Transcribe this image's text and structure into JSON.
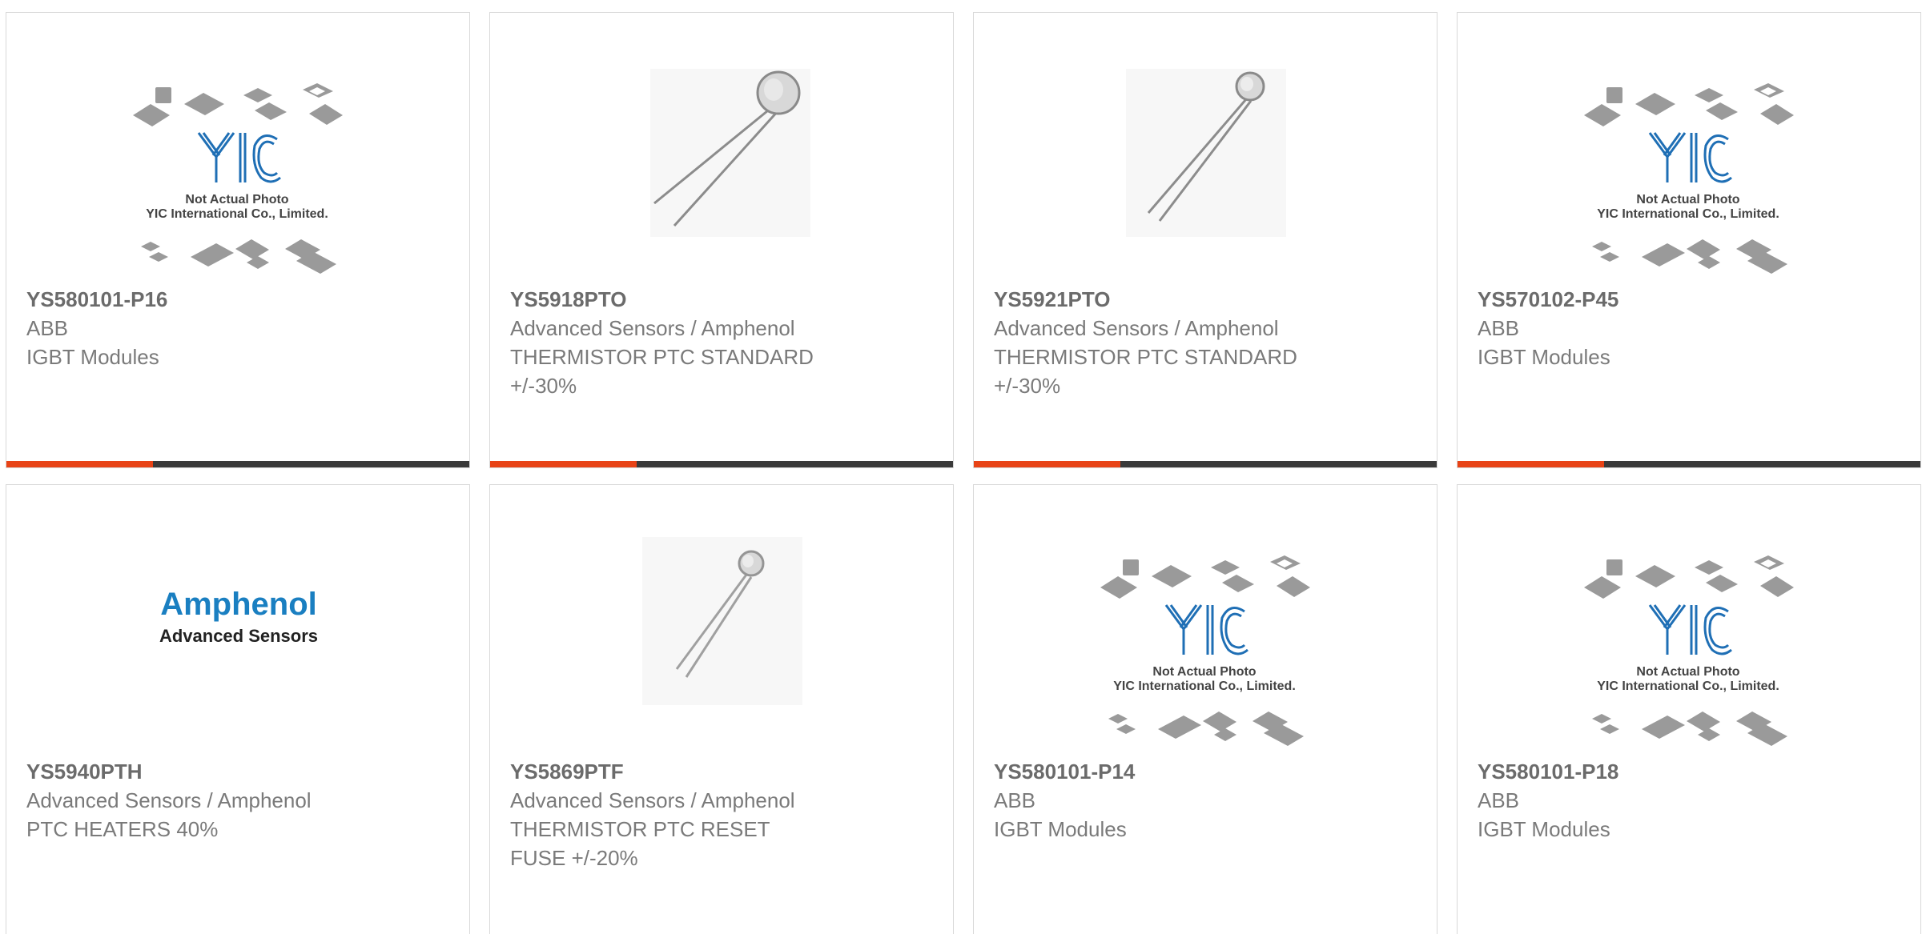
{
  "products": [
    {
      "part_number": "YS580101-P16",
      "manufacturer": "ABB",
      "description_lines": [
        "IGBT Modules"
      ],
      "image": "yic-placeholder",
      "placeholder_text": [
        "Not Actual Photo",
        "YIC International Co., Limited."
      ]
    },
    {
      "part_number": "YS5918PTO",
      "manufacturer": "Advanced Sensors / Amphenol",
      "description_lines": [
        "THERMISTOR PTC STANDARD",
        "+/-30%"
      ],
      "image": "thermistor-photo"
    },
    {
      "part_number": "YS5921PTO",
      "manufacturer": "Advanced Sensors / Amphenol",
      "description_lines": [
        "THERMISTOR PTC STANDARD",
        "+/-30%"
      ],
      "image": "thermistor-photo"
    },
    {
      "part_number": "YS570102-P45",
      "manufacturer": "ABB",
      "description_lines": [
        "IGBT Modules"
      ],
      "image": "yic-placeholder",
      "placeholder_text": [
        "Not Actual Photo",
        "YIC International Co., Limited."
      ]
    },
    {
      "part_number": "YS5940PTH",
      "manufacturer": "Advanced Sensors / Amphenol",
      "description_lines": [
        "PTC HEATERS 40%"
      ],
      "image": "amphenol-logo",
      "logo_text": [
        "Amphenol",
        "Advanced Sensors"
      ]
    },
    {
      "part_number": "YS5869PTF",
      "manufacturer": "Advanced Sensors / Amphenol",
      "description_lines": [
        "THERMISTOR PTC RESET",
        "FUSE +/-20%"
      ],
      "image": "thermistor-photo"
    },
    {
      "part_number": "YS580101-P14",
      "manufacturer": "ABB",
      "description_lines": [
        "IGBT Modules"
      ],
      "image": "yic-placeholder",
      "placeholder_text": [
        "Not Actual Photo",
        "YIC International Co., Limited."
      ]
    },
    {
      "part_number": "YS580101-P18",
      "manufacturer": "ABB",
      "description_lines": [
        "IGBT Modules"
      ],
      "image": "yic-placeholder",
      "placeholder_text": [
        "Not Actual Photo",
        "YIC International Co., Limited."
      ]
    }
  ],
  "colors": {
    "accent_bar": "#e84316",
    "dark_bar": "#3a3a3a",
    "card_border": "#d9d9d9",
    "part_text": "#6b6b6b",
    "body_text": "#7a7a7a",
    "yic_logo": "#1f6fb5",
    "amphenol_blue": "#1a7fc1"
  }
}
